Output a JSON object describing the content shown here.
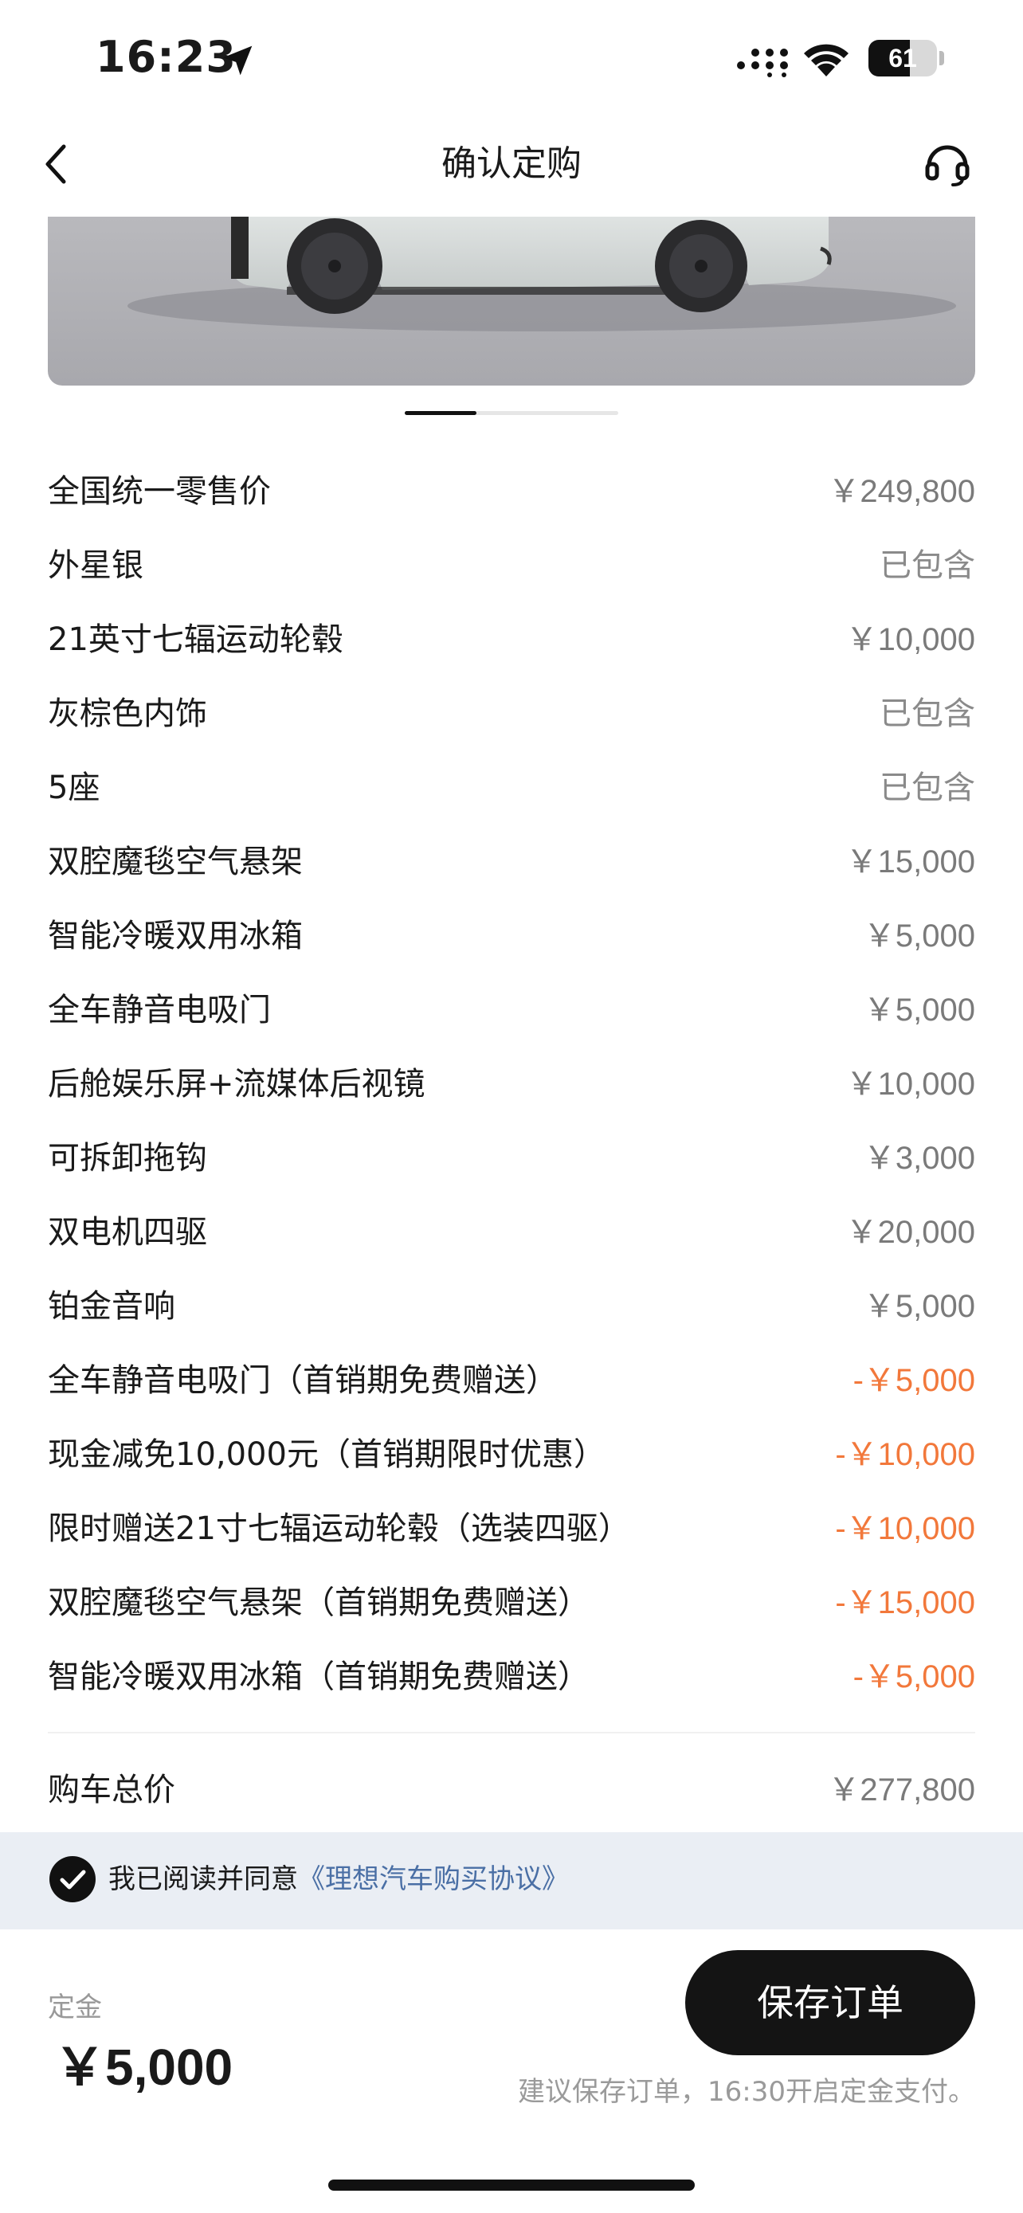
{
  "status_bar": {
    "time": "16:23",
    "battery": "61",
    "battery_level": 0.61
  },
  "nav": {
    "title": "确认定购"
  },
  "carousel": {
    "pages": 3,
    "active_index": 0
  },
  "items": [
    {
      "label": "全国统一零售价",
      "value": "￥249,800",
      "kind": "price"
    },
    {
      "label": "外星银",
      "value": "已包含",
      "kind": "included"
    },
    {
      "label": "21英寸七辐运动轮毂",
      "value": "￥10,000",
      "kind": "price"
    },
    {
      "label": "灰棕色内饰",
      "value": "已包含",
      "kind": "included"
    },
    {
      "label": "5座",
      "value": "已包含",
      "kind": "included"
    },
    {
      "label": "双腔魔毯空气悬架",
      "value": "￥15,000",
      "kind": "price"
    },
    {
      "label": "智能冷暖双用冰箱",
      "value": "￥5,000",
      "kind": "price"
    },
    {
      "label": "全车静音电吸门",
      "value": "￥5,000",
      "kind": "price"
    },
    {
      "label": "后舱娱乐屏+流媒体后视镜",
      "value": "￥10,000",
      "kind": "price"
    },
    {
      "label": "可拆卸拖钩",
      "value": "￥3,000",
      "kind": "price"
    },
    {
      "label": "双电机四驱",
      "value": "￥20,000",
      "kind": "price"
    },
    {
      "label": "铂金音响",
      "value": "￥5,000",
      "kind": "price"
    },
    {
      "label": "全车静音电吸门（首销期免费赠送）",
      "value": "-￥5,000",
      "kind": "discount"
    },
    {
      "label": "现金减免10,000元（首销期限时优惠）",
      "value": "-￥10,000",
      "kind": "discount"
    },
    {
      "label": "限时赠送21寸七辐运动轮毂（选装四驱）",
      "value": "-￥10,000",
      "kind": "discount"
    },
    {
      "label": "双腔魔毯空气悬架（首销期免费赠送）",
      "value": "-￥15,000",
      "kind": "discount"
    },
    {
      "label": "智能冷暖双用冰箱（首销期免费赠送）",
      "value": "-￥5,000",
      "kind": "discount"
    }
  ],
  "total": {
    "label": "购车总价",
    "value": "￥277,800"
  },
  "agreement": {
    "text": "我已阅读并同意",
    "link": "《理想汽车购买协议》",
    "checked": true
  },
  "deposit": {
    "label": "定金",
    "amount": "￥5,000"
  },
  "save_button": "保存订单",
  "hint": "建议保存订单，16:30开启定金支付。",
  "colors": {
    "discount": "#f2783b",
    "link": "#4a6fa5",
    "button": "#141414",
    "agree_bg": "#eaeef4"
  }
}
